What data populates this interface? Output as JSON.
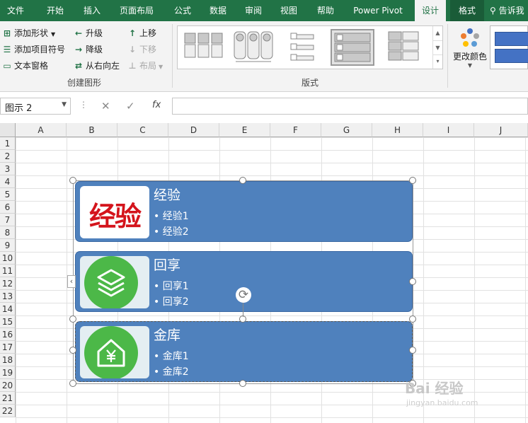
{
  "ribbon_tabs": [
    "文件",
    "开始",
    "插入",
    "页面布局",
    "公式",
    "数据",
    "审阅",
    "视图",
    "帮助",
    "Power Pivot",
    "设计",
    "格式"
  ],
  "tell_me": "告诉我",
  "create_graphic": {
    "add_shape": "添加形状",
    "add_bullet": "添加项目符号",
    "text_pane": "文本窗格",
    "promote": "升级",
    "demote": "降级",
    "right_to_left": "从右向左",
    "move_up": "上移",
    "move_down": "下移",
    "layout": "布局",
    "group_label": "创建图形"
  },
  "layouts": {
    "group_label": "版式"
  },
  "change_colors": "更改颜色",
  "name_box": "图示 2",
  "formula_buttons": {
    "cancel": "✕",
    "enter": "✓",
    "fx": "fx"
  },
  "columns": [
    "A",
    "B",
    "C",
    "D",
    "E",
    "F",
    "G",
    "H",
    "I",
    "J"
  ],
  "rows": [
    "1",
    "2",
    "3",
    "4",
    "5",
    "6",
    "7",
    "8",
    "9",
    "10",
    "11",
    "12",
    "13",
    "14",
    "15",
    "16",
    "17",
    "18",
    "19",
    "20",
    "21",
    "22"
  ],
  "smartart": {
    "items": [
      {
        "title": "经验",
        "bullets": [
          "经验1",
          "经验2"
        ],
        "picture_text": "经验"
      },
      {
        "title": "回享",
        "bullets": [
          "回享1",
          "回享2"
        ],
        "picture_icon": "layers-icon"
      },
      {
        "title": "金库",
        "bullets": [
          "金库1",
          "金库2"
        ],
        "picture_icon": "house-yuan-icon"
      }
    ],
    "fill_color": "#4f81bd"
  },
  "watermark": {
    "main": "Bai 经验",
    "sub": "jingyan.baidu.com"
  },
  "colors": {
    "excel_green": "#217346",
    "shape_blue": "#4f81bd",
    "icon_green": "#4cb848",
    "logo_red": "#d4141c"
  }
}
